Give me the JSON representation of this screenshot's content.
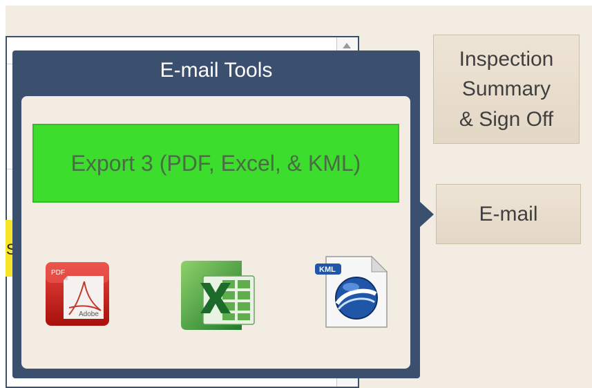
{
  "popover": {
    "title": "E-mail Tools",
    "export_label": "Export 3 (PDF, Excel, & KML)",
    "icons": {
      "pdf": {
        "name": "pdf-icon",
        "label_top": "PDF",
        "label_bottom": "Adobe"
      },
      "excel": {
        "name": "excel-icon"
      },
      "kml": {
        "name": "kml-icon",
        "badge": "KML"
      }
    }
  },
  "side_buttons": {
    "inspection_line1": "Inspection",
    "inspection_line2": "Summary",
    "inspection_line3": "& Sign Off",
    "email": "E-mail"
  },
  "background": {
    "yellow_cell_char": "S"
  },
  "colors": {
    "popover_frame": "#3b4f6e",
    "export_button": "#3ddd2e",
    "page_bg": "#f3ece2"
  }
}
